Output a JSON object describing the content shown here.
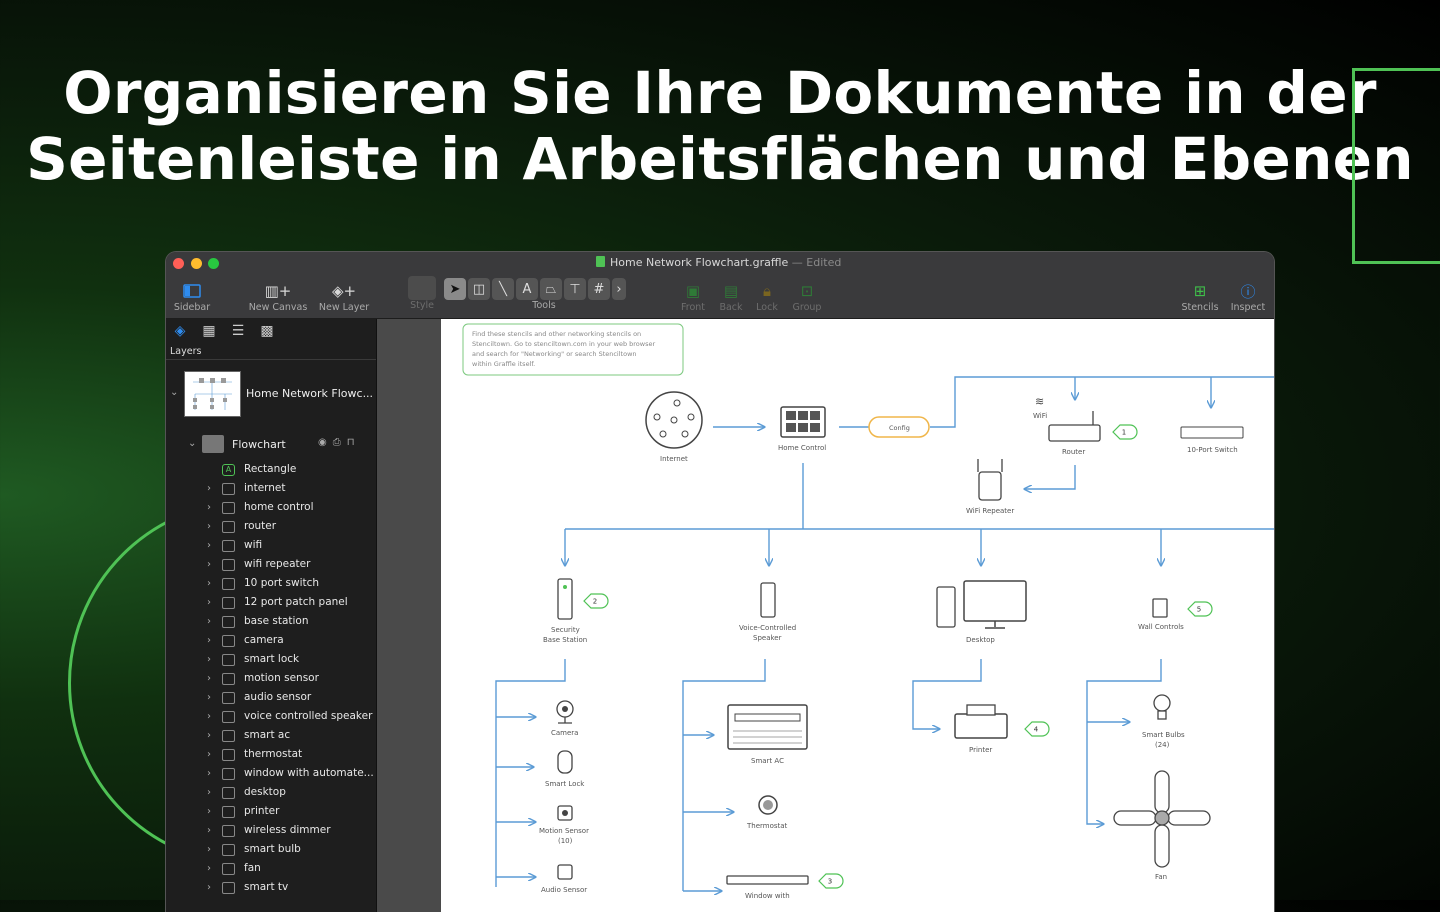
{
  "headline": {
    "line1": "Organisieren Sie Ihre Dokumente in der",
    "line2": "Seitenleiste in Arbeitsflächen und Ebenen"
  },
  "window": {
    "doc_title": "Home Network Flowchart.graffle",
    "doc_separator": "—",
    "doc_status": "Edited"
  },
  "toolbar": {
    "sidebar": "Sidebar",
    "new_canvas": "New Canvas",
    "new_layer": "New Layer",
    "style": "Style",
    "tools": "Tools",
    "front": "Front",
    "back": "Back",
    "lock": "Lock",
    "group": "Group",
    "stencils": "Stencils",
    "inspect": "Inspect"
  },
  "sidebar": {
    "label": "Layers",
    "canvas_name": "Home Network Flowc...",
    "layer_name": "Flowchart",
    "items": [
      {
        "label": "Rectangle",
        "icon": "text-shape-icon"
      },
      {
        "label": "internet",
        "icon": "group-icon"
      },
      {
        "label": "home control",
        "icon": "group-icon"
      },
      {
        "label": "router",
        "icon": "group-icon"
      },
      {
        "label": "wifi",
        "icon": "group-icon"
      },
      {
        "label": "wifi repeater",
        "icon": "group-icon"
      },
      {
        "label": "10 port switch",
        "icon": "group-icon"
      },
      {
        "label": "12 port patch panel",
        "icon": "group-icon"
      },
      {
        "label": "base station",
        "icon": "group-icon"
      },
      {
        "label": "camera",
        "icon": "group-icon"
      },
      {
        "label": "smart lock",
        "icon": "group-icon"
      },
      {
        "label": "motion sensor",
        "icon": "group-icon"
      },
      {
        "label": "audio sensor",
        "icon": "group-icon"
      },
      {
        "label": "voice controlled speaker",
        "icon": "group-icon"
      },
      {
        "label": "smart ac",
        "icon": "group-icon"
      },
      {
        "label": "thermostat",
        "icon": "group-icon"
      },
      {
        "label": "window with automate...",
        "icon": "group-icon"
      },
      {
        "label": "desktop",
        "icon": "group-icon"
      },
      {
        "label": "printer",
        "icon": "group-icon"
      },
      {
        "label": "wireless dimmer",
        "icon": "group-icon"
      },
      {
        "label": "smart bulb",
        "icon": "group-icon"
      },
      {
        "label": "fan",
        "icon": "group-icon"
      },
      {
        "label": "smart tv",
        "icon": "group-icon"
      }
    ]
  },
  "canvas": {
    "note_line1": "Find these stencils and other networking stencils on",
    "note_line2": "Stenciltown. Go to stenciltown.com in your web browser",
    "note_line3": "and search for \"Networking\" or search Stenciltown",
    "note_line4": "within Graffle itself.",
    "internet": "Internet",
    "home_control": "Home Control",
    "config": "Config",
    "wifi": "WiFi",
    "router": "Router",
    "switch": "10-Port Switch",
    "repeater": "WiFi Repeater",
    "security1": "Security",
    "security2": "Base Station",
    "voice1": "Voice-Controlled",
    "voice2": "Speaker",
    "desktop": "Desktop",
    "wall": "Wall Controls",
    "camera": "Camera",
    "smart_lock": "Smart Lock",
    "motion1": "Motion Sensor",
    "motion2": "(10)",
    "audio": "Audio Sensor",
    "smart_ac": "Smart AC",
    "thermostat": "Thermostat",
    "window": "Window with",
    "printer": "Printer",
    "bulbs1": "Smart Bulbs",
    "bulbs2": "(24)",
    "fan": "Fan",
    "badges": [
      "1",
      "2",
      "3",
      "4",
      "5"
    ]
  },
  "colors": {
    "accent_green": "#4fc255",
    "connector_blue": "#5b9bd5",
    "config_orange": "#f0b64a"
  }
}
